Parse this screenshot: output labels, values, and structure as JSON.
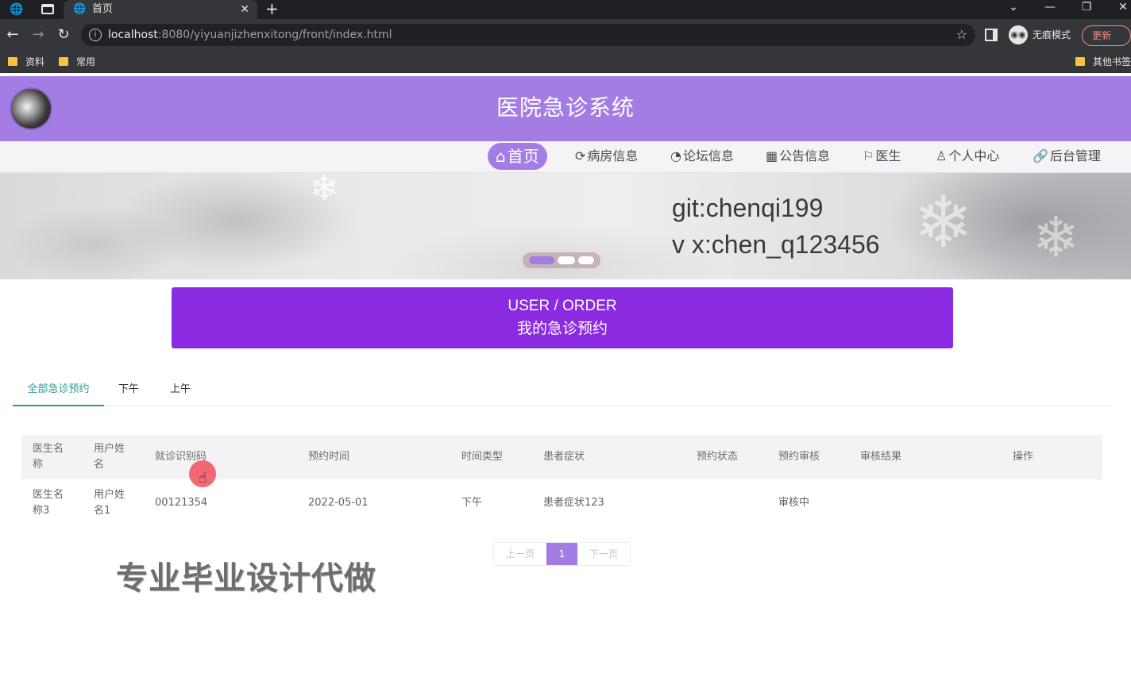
{
  "browser": {
    "tab_title": "首页",
    "url_host": "localhost",
    "url_rest": ":8080/yiyuanjizhenxitong/front/index.html",
    "incognito_label": "无痕模式",
    "update_label": "更新",
    "bookmarks": [
      "资料",
      "常用"
    ],
    "other_bookmarks": "其他书签"
  },
  "site": {
    "title": "医院急诊系统",
    "nav": [
      "首页",
      "病房信息",
      "论坛信息",
      "公告信息",
      "医生",
      "个人中心",
      "后台管理"
    ],
    "nav_icons": [
      "home-icon",
      "ward-icon",
      "forum-icon",
      "notice-icon",
      "flag-icon",
      "user-icon",
      "link-icon"
    ]
  },
  "banner": {
    "line1": "git:chenqi199",
    "line2": "v x:chen_q123456",
    "active_slide": 1,
    "slide_count": 3
  },
  "section": {
    "title_en": "USER / ORDER",
    "title_cn": "我的急诊预约"
  },
  "tabs": [
    "全部急诊预约",
    "下午",
    "上午"
  ],
  "active_tab": 0,
  "table": {
    "headers": [
      "医生名称",
      "用户姓名",
      "就诊识别码",
      "预约时间",
      "时间类型",
      "患者症状",
      "预约状态",
      "预约审核",
      "审核结果",
      "操作"
    ],
    "rows": [
      [
        "医生名称3",
        "用户姓名1",
        "00121354",
        "2022-05-01",
        "下午",
        "患者症状123",
        "",
        "审核中",
        "",
        ""
      ]
    ]
  },
  "pagination": {
    "prev": "上一页",
    "current": "1",
    "next": "下一页"
  },
  "watermark": "专业毕业设计代做",
  "colors": {
    "header": "#a47de4",
    "title_block": "#8a2be2",
    "active_tab": "#2a9d8f"
  }
}
